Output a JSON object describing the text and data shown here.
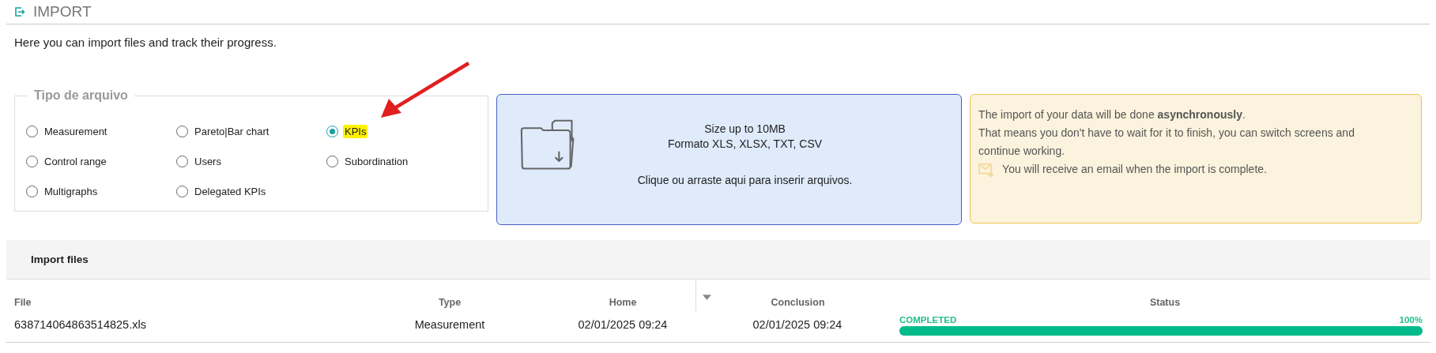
{
  "page": {
    "title": "IMPORT",
    "description": "Here you can import files and track their progress."
  },
  "file_type": {
    "legend": "Tipo de arquivo",
    "options": [
      {
        "label": "Measurement",
        "selected": false,
        "highlighted": false
      },
      {
        "label": "Pareto|Bar chart",
        "selected": false,
        "highlighted": false
      },
      {
        "label": "KPIs",
        "selected": true,
        "highlighted": true
      },
      {
        "label": "Control range",
        "selected": false,
        "highlighted": false
      },
      {
        "label": "Users",
        "selected": false,
        "highlighted": false
      },
      {
        "label": "Subordination",
        "selected": false,
        "highlighted": false
      },
      {
        "label": "Multigraphs",
        "selected": false,
        "highlighted": false
      },
      {
        "label": "Delegated KPIs",
        "selected": false,
        "highlighted": false
      }
    ]
  },
  "dropzone": {
    "lines": [
      "Size up to 10MB",
      "Formato XLS, XLSX, TXT, CSV"
    ],
    "hint": "Clique ou arraste aqui para inserir arquivos."
  },
  "notice": {
    "lines": [
      "The import of your data will be done **asynchronously**.",
      "That means you don't have to wait for it to finish, you can switch screens and continue working."
    ],
    "email_note": "You will receive an email when the import is complete."
  },
  "table": {
    "title": "Import files",
    "columns": [
      "File",
      "Type",
      "Home",
      "Conclusion",
      "Status"
    ],
    "rows": [
      {
        "file": "638714064863514825.xls",
        "type": "Measurement",
        "home": "02/01/2025 09:24",
        "conclusion": "02/01/2025 09:24",
        "status": "COMPLETED",
        "percent": "100%",
        "level": 1
      }
    ]
  }
}
